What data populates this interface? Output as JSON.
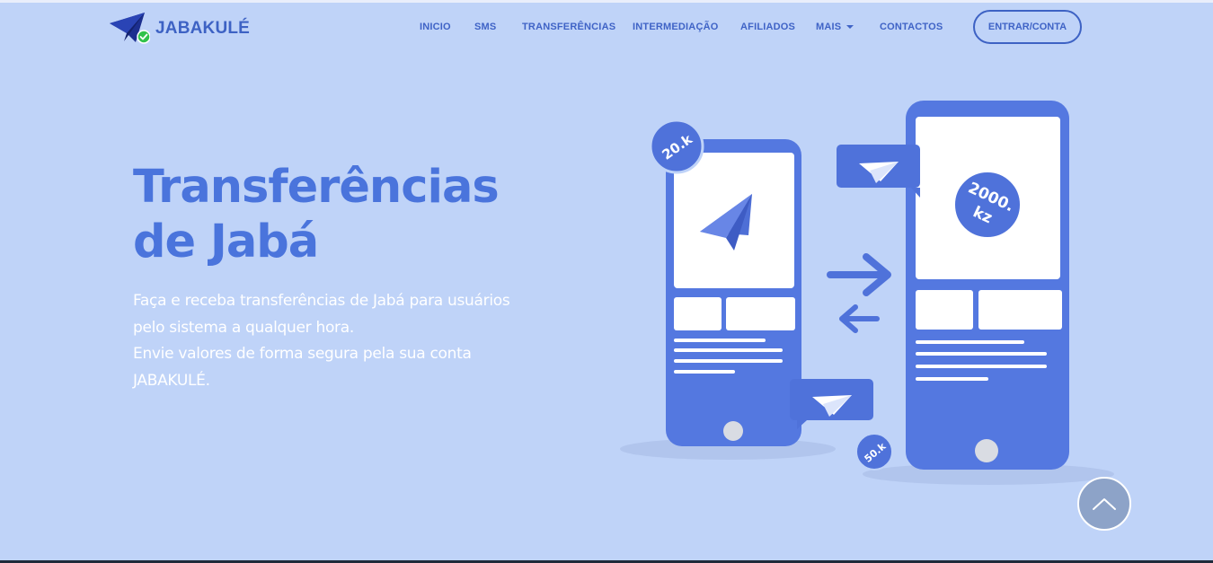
{
  "brand": {
    "name": "JABAKULÉ",
    "logo_icon": "paper-plane-check-icon"
  },
  "nav": {
    "items": [
      {
        "id": "inicio",
        "label": "INICIO"
      },
      {
        "id": "sms",
        "label": "SMS"
      },
      {
        "id": "transferencias",
        "label": "TRANSFERÊNCIAS"
      },
      {
        "id": "intermediacao",
        "label": "INTERMEDIAÇÃO"
      },
      {
        "id": "afiliados",
        "label": "AFILIADOS"
      },
      {
        "id": "mais",
        "label": "MAIS"
      },
      {
        "id": "contactos",
        "label": "CONTACTOS"
      }
    ],
    "login_label": "ENTRAR/CONTA"
  },
  "hero": {
    "title_line1": "Transferências",
    "title_line2": "de Jabá",
    "desc_line1": "Faça e receba transferências de Jabá para usuários",
    "desc_line2": "pelo sistema a qualquer hora.",
    "desc_line3": "Envie valores de forma segura pela sua conta",
    "desc_line4": "JABAKULÉ."
  },
  "illustration": {
    "badge_top_left": "20.k",
    "badge_bottom": "50.k",
    "badge_amount_line1": "2000.",
    "badge_amount_line2": "kz"
  },
  "colors": {
    "background": "#bfd3f8",
    "accent": "#3d62c4",
    "title": "#4a74dc",
    "phone": "#5478e0"
  },
  "scroll_top_icon": "chevron-up-icon"
}
